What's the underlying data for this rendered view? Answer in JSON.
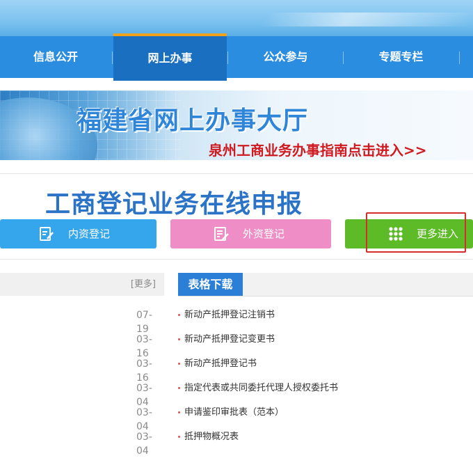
{
  "nav": {
    "items": [
      {
        "label": "信息公开"
      },
      {
        "label": "网上办事"
      },
      {
        "label": "公众参与"
      },
      {
        "label": "专题专栏"
      }
    ]
  },
  "banner": {
    "title": "福建省网上办事大厅",
    "link": "泉州工商业务办事指南点击进入>>"
  },
  "section": {
    "title": "工商登记业务在线申报"
  },
  "buttons": {
    "domestic": "内资登记",
    "foreign": "外资登记",
    "more": "更多进入"
  },
  "left_panel": {
    "more_label": "[更多]"
  },
  "forms": {
    "tab_label": "表格下载",
    "items": [
      {
        "date": "07-19",
        "title": "新动产抵押登记注销书"
      },
      {
        "date": "03-16",
        "title": "新动产抵押登记变更书"
      },
      {
        "date": "03-16",
        "title": "新动产抵押登记书"
      },
      {
        "date": "03-04",
        "title": "指定代表或共同委托代理人授权委托书"
      },
      {
        "date": "03-04",
        "title": "申请鉴印审批表（范本）"
      },
      {
        "date": "03-04",
        "title": "抵押物概况表"
      }
    ]
  },
  "colors": {
    "nav_bg": "#2b8ddf",
    "nav_active": "#1b6fc0",
    "accent_orange": "#f0a21a",
    "btn_blue": "#36a6ec",
    "btn_pink": "#ef8ec6",
    "btn_green": "#5dbb27",
    "highlight_red": "#d82b2b"
  }
}
